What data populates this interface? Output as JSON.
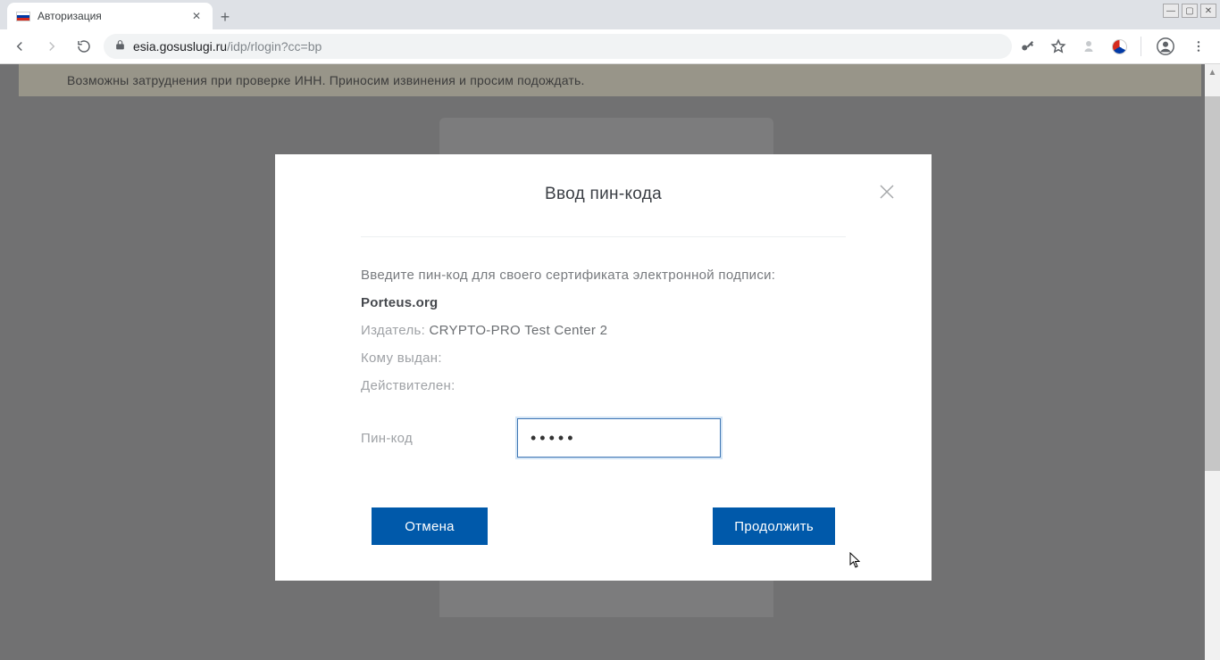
{
  "tab": {
    "title": "Авторизация"
  },
  "url": {
    "host": "esia.gosuslugi.ru",
    "path": "/idp/rlogin?cc=bp"
  },
  "notice": {
    "text": "Возможны затруднения при проверке ИНН. Приносим извинения и просим подождать."
  },
  "modal": {
    "title": "Ввод пин-кода",
    "instruction": "Введите пин-код для своего сертификата электронной подписи:",
    "cert_name": "Porteus.org",
    "issuer_label": "Издатель:",
    "issuer_value": "CRYPTO-PRO Test Center 2",
    "issued_to_label": "Кому выдан:",
    "issued_to_value": "",
    "valid_label": "Действителен:",
    "valid_value": "",
    "pin_label": "Пин-код",
    "pin_value": "•••••",
    "cancel": "Отмена",
    "continue": "Продолжить"
  }
}
